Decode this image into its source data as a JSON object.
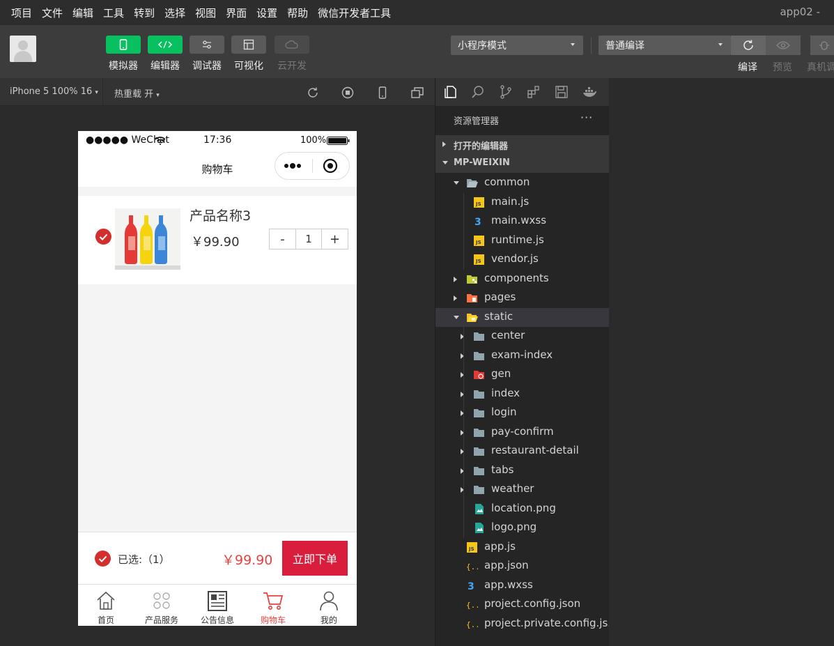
{
  "menubar": {
    "items": [
      "项目",
      "文件",
      "编辑",
      "工具",
      "转到",
      "选择",
      "视图",
      "界面",
      "设置",
      "帮助",
      "微信开发者工具"
    ],
    "app_title": "app02 -"
  },
  "toolbar": {
    "tools": [
      {
        "label": "模拟器",
        "icon": "phone-icon"
      },
      {
        "label": "编辑器",
        "icon": "code-icon"
      },
      {
        "label": "调试器",
        "icon": "sliders-icon"
      },
      {
        "label": "可视化",
        "icon": "layout-icon"
      },
      {
        "label": "云开发",
        "icon": "cloud-icon"
      }
    ],
    "mode_select": "小程序模式",
    "compile_select": "普通编译",
    "compile_label": "编译",
    "preview_label": "预览",
    "device_label": "真机调"
  },
  "simbar": {
    "device": "iPhone 5 100% 16",
    "hot_reload": "热重载 开"
  },
  "phone": {
    "status": {
      "carrier": "●●●●● WeChat",
      "time": "17:36",
      "battery": "100%"
    },
    "nav_title": "购物车",
    "item": {
      "name": "产品名称3",
      "price": "￥99.90",
      "qty": "1",
      "minus": "-",
      "plus": "+"
    },
    "footer": {
      "selected": "已选:（1）",
      "total": "￥99.90",
      "order": "立即下单"
    },
    "tabs": [
      {
        "label": "首页",
        "icon": "home-icon"
      },
      {
        "label": "产品服务",
        "icon": "grid-icon"
      },
      {
        "label": "公告信息",
        "icon": "news-icon"
      },
      {
        "label": "购物车",
        "icon": "cart-icon"
      },
      {
        "label": "我的",
        "icon": "user-icon"
      }
    ]
  },
  "explorer": {
    "title": "资源管理器",
    "more": "···",
    "open_editors": "打开的编辑器",
    "project": "MP-WEIXIN",
    "tree": [
      {
        "name": "common",
        "depth": 1,
        "type": "folder-open"
      },
      {
        "name": "main.js",
        "depth": 2,
        "type": "js"
      },
      {
        "name": "main.wxss",
        "depth": 2,
        "type": "css"
      },
      {
        "name": "runtime.js",
        "depth": 2,
        "type": "js"
      },
      {
        "name": "vendor.js",
        "depth": 2,
        "type": "js"
      },
      {
        "name": "components",
        "depth": 1,
        "type": "folder-components"
      },
      {
        "name": "pages",
        "depth": 1,
        "type": "folder-pages"
      },
      {
        "name": "static",
        "depth": 1,
        "type": "folder-static-open"
      },
      {
        "name": "center",
        "depth": 2,
        "type": "folder"
      },
      {
        "name": "exam-index",
        "depth": 2,
        "type": "folder"
      },
      {
        "name": "gen",
        "depth": 2,
        "type": "folder-gen"
      },
      {
        "name": "index",
        "depth": 2,
        "type": "folder"
      },
      {
        "name": "login",
        "depth": 2,
        "type": "folder"
      },
      {
        "name": "pay-confirm",
        "depth": 2,
        "type": "folder"
      },
      {
        "name": "restaurant-detail",
        "depth": 2,
        "type": "folder"
      },
      {
        "name": "tabs",
        "depth": 2,
        "type": "folder"
      },
      {
        "name": "weather",
        "depth": 2,
        "type": "folder"
      },
      {
        "name": "location.png",
        "depth": 2,
        "type": "image"
      },
      {
        "name": "logo.png",
        "depth": 2,
        "type": "image"
      },
      {
        "name": "app.js",
        "depth": 1,
        "type": "js"
      },
      {
        "name": "app.json",
        "depth": 1,
        "type": "json"
      },
      {
        "name": "app.wxss",
        "depth": 1,
        "type": "css"
      },
      {
        "name": "project.config.json",
        "depth": 1,
        "type": "json"
      },
      {
        "name": "project.private.config.js...",
        "depth": 1,
        "type": "json"
      }
    ]
  },
  "colors": {
    "accent_green": "#07c160",
    "cart_red": "#e64340",
    "order_red": "#d81e3c"
  }
}
